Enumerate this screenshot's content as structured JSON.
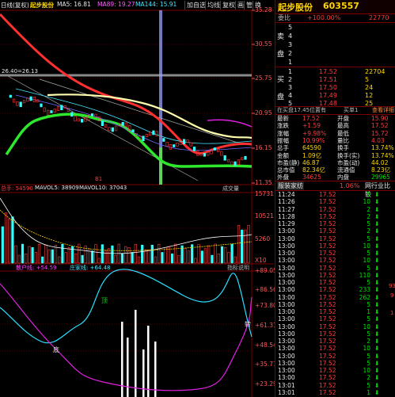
{
  "title_bar": {
    "period": "日线(复权)",
    "name": "起步股份",
    "ma5_label": "MA5: 16.81",
    "ma89_label": "MA89: 19.27",
    "ma144_label": "MA144: 15.91",
    "buttons": [
      "加自选",
      "均线",
      "复权",
      "画",
      "管",
      "换"
    ]
  },
  "price_axis": [
    "35.28",
    "30.55",
    "25.75",
    "20.95",
    "16.15",
    "11.35"
  ],
  "price_annotation": "26.40=26.13",
  "volume_header": {
    "vol_label": "总手: 54590",
    "mavol5": "MAVOL5: 38909",
    "mavol10": "MAVOL10: 37043",
    "tab": "成交量"
  },
  "volume_axis": [
    "15731",
    "10521",
    "5260",
    "X10"
  ],
  "indicator_header": {
    "label1": "散户线: +54.59",
    "label2": "庄家线: +64.48",
    "tab": "指标说明"
  },
  "indicator_axis": [
    "+89.05",
    "+86.56",
    "+73.80",
    "+61.31",
    "+48.54",
    "+35.77",
    "+23.29"
  ],
  "indicator_marks": [
    "顶",
    "底",
    "转"
  ],
  "stock": {
    "name": "起步股份",
    "code": "603557"
  },
  "order_book": {
    "weibi_label": "委比",
    "weibi_value": "+100.00%",
    "weicha_value": "22770",
    "sell": [
      {
        "level": "5",
        "price": "",
        "vol": ""
      },
      {
        "level": "4",
        "price": "",
        "vol": ""
      },
      {
        "level": "3",
        "price": "",
        "vol": ""
      },
      {
        "level": "2",
        "price": "",
        "vol": ""
      },
      {
        "level": "1",
        "price": "",
        "vol": ""
      }
    ],
    "buy": [
      {
        "level": "1",
        "price": "17.52",
        "vol": "22704"
      },
      {
        "level": "2",
        "price": "17.51",
        "vol": "5"
      },
      {
        "level": "3",
        "price": "17.50",
        "vol": "24"
      },
      {
        "level": "4",
        "price": "17.49",
        "vol": "12"
      },
      {
        "level": "5",
        "price": "17.48",
        "vol": "25"
      }
    ],
    "sell_side_label": [
      "卖",
      "盘"
    ],
    "buy_side_label": [
      "买",
      "盘"
    ]
  },
  "summary_bar": {
    "left": "在买盘17.45位置有",
    "right": "买单1",
    "link": "查看详细"
  },
  "quote": [
    {
      "k1": "最新",
      "v1": "17.52",
      "k2": "开盘",
      "v2": "15.90"
    },
    {
      "k1": "涨跌",
      "v1": "+1.59",
      "k2": "最高",
      "v2": "17.52"
    },
    {
      "k1": "涨幅",
      "v1": "+9.98%",
      "k2": "最低",
      "v2": "15.72"
    },
    {
      "k1": "振幅",
      "v1": "10.99%",
      "k2": "量比",
      "v2": "4.03"
    },
    {
      "k1": "总手",
      "v1": "64590",
      "k2": "换手",
      "v2": "13.74%"
    },
    {
      "k1": "金额",
      "v1": "1.09亿",
      "k2": "换手(实)",
      "v2": "13.74%"
    },
    {
      "k1": "市盈(静)",
      "v1": "46.87",
      "k2": "市盈(动)",
      "v2": "44.02"
    },
    {
      "k1": "总市值",
      "v1": "82.34亿",
      "k2": "流通值",
      "v2": "8.23亿"
    },
    {
      "k1": "外盘",
      "v1": "34625",
      "k2": "内盘",
      "v2": "29965"
    }
  ],
  "tabs": {
    "left": "服装家纺",
    "mid": "1.06%",
    "right": "网行业比较"
  },
  "ticks": [
    {
      "t": "11:24",
      "p": "17.52",
      "v": "5"
    },
    {
      "t": "11:26",
      "p": "17.52",
      "v": "10"
    },
    {
      "t": "11:27",
      "p": "17.52",
      "v": "2"
    },
    {
      "t": "11:28",
      "p": "17.52",
      "v": "2"
    },
    {
      "t": "11:29",
      "p": "17.52",
      "v": "5"
    },
    {
      "t": "13:00",
      "p": "17.52",
      "v": "2"
    },
    {
      "t": "13:00",
      "p": "17.52",
      "v": "5"
    },
    {
      "t": "13:00",
      "p": "17.52",
      "v": "10"
    },
    {
      "t": "13:00",
      "p": "17.52",
      "v": "5"
    },
    {
      "t": "13:00",
      "p": "17.52",
      "v": "10"
    },
    {
      "t": "13:00",
      "p": "17.52",
      "v": "5"
    },
    {
      "t": "13:00",
      "p": "17.52",
      "v": "110"
    },
    {
      "t": "13:00",
      "p": "17.52",
      "v": "5"
    },
    {
      "t": "13:00",
      "p": "17.52",
      "v": "233"
    },
    {
      "t": "13:00",
      "p": "17.52",
      "v": "262"
    },
    {
      "t": "13:00",
      "p": "17.52",
      "v": "5"
    },
    {
      "t": "13:00",
      "p": "17.52",
      "v": "1"
    },
    {
      "t": "13:00",
      "p": "17.52",
      "v": "5"
    },
    {
      "t": "13:00",
      "p": "17.52",
      "v": "10"
    },
    {
      "t": "13:00",
      "p": "17.52",
      "v": "5"
    },
    {
      "t": "13:00",
      "p": "17.52",
      "v": "2"
    },
    {
      "t": "13:00",
      "p": "17.52",
      "v": "10"
    },
    {
      "t": "13:00",
      "p": "17.52",
      "v": "5"
    },
    {
      "t": "13:00",
      "p": "17.52",
      "v": "5"
    },
    {
      "t": "13:00",
      "p": "17.52",
      "v": "10"
    },
    {
      "t": "13:00",
      "p": "17.52",
      "v": "2"
    },
    {
      "t": "13:01",
      "p": "17.52",
      "v": "5"
    },
    {
      "t": "13:01",
      "p": "17.52",
      "v": "1"
    }
  ],
  "tick_side_marks": [
    "93",
    "9",
    "1"
  ],
  "colors": {
    "up": "#ff3b3b",
    "down": "#00e000",
    "ma_yellow": "#ffffb0",
    "ma_red": "#ff3030",
    "ma_green": "#2ee82e",
    "cyan_line": "#46e6ff",
    "magenta_line": "#e020e0"
  }
}
